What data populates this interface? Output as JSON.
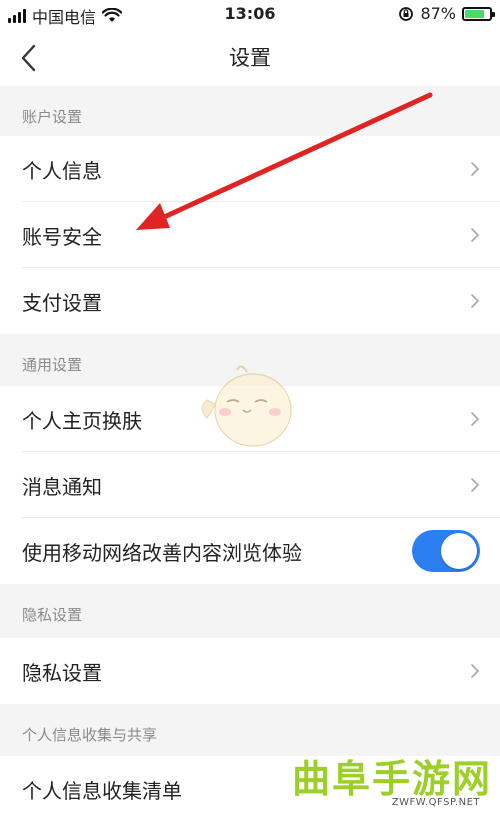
{
  "status_bar": {
    "carrier": "中国电信",
    "time": "13:06",
    "battery": "87%",
    "battery_level": 0.87
  },
  "nav": {
    "title": "设置"
  },
  "sections": [
    {
      "header": "账户设置"
    },
    {
      "header": "通用设置"
    },
    {
      "header": "隐私设置"
    },
    {
      "header": "个人信息收集与共享"
    }
  ],
  "rows": {
    "personal_info": "个人信息",
    "account_security": "账号安全",
    "payment_settings": "支付设置",
    "homepage_skin": "个人主页换肤",
    "notifications": "消息通知",
    "mobile_network": "使用移动网络改善内容浏览体验",
    "privacy_settings": "隐私设置",
    "info_collection_list": "个人信息收集清单"
  },
  "toggles": {
    "mobile_network_enabled": true
  },
  "watermark": {
    "main": "曲阜手游网",
    "sub": "ZWFW.QFSP.NET"
  },
  "colors": {
    "toggle_on": "#2b7ff0",
    "arrow": "#e02424",
    "watermark": "#9ccf27"
  }
}
